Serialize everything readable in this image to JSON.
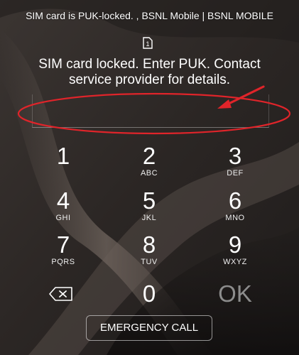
{
  "status_bar": {
    "text": "SIM card is PUK-locked. , BSNL Mobile | BSNL MOBILE"
  },
  "sim_indicator": {
    "label": "1",
    "icon": "sim-card-icon"
  },
  "message": {
    "line1": "SIM card locked. Enter PUK. Contact",
    "line2": "service provider for details."
  },
  "puk_input": {
    "value": "",
    "placeholder": ""
  },
  "keypad": {
    "keys": [
      {
        "digit": "1",
        "letters": ""
      },
      {
        "digit": "2",
        "letters": "ABC"
      },
      {
        "digit": "3",
        "letters": "DEF"
      },
      {
        "digit": "4",
        "letters": "GHI"
      },
      {
        "digit": "5",
        "letters": "JKL"
      },
      {
        "digit": "6",
        "letters": "MNO"
      },
      {
        "digit": "7",
        "letters": "PQRS"
      },
      {
        "digit": "8",
        "letters": "TUV"
      },
      {
        "digit": "9",
        "letters": "WXYZ"
      },
      {
        "digit": "0",
        "letters": ""
      }
    ],
    "backspace_icon": "backspace-icon",
    "ok_label": "OK"
  },
  "emergency_button": {
    "label": "EMERGENCY CALL"
  },
  "annotation": {
    "color": "#e0242a",
    "icons": [
      "red-ellipse-highlight",
      "red-arrow"
    ]
  }
}
